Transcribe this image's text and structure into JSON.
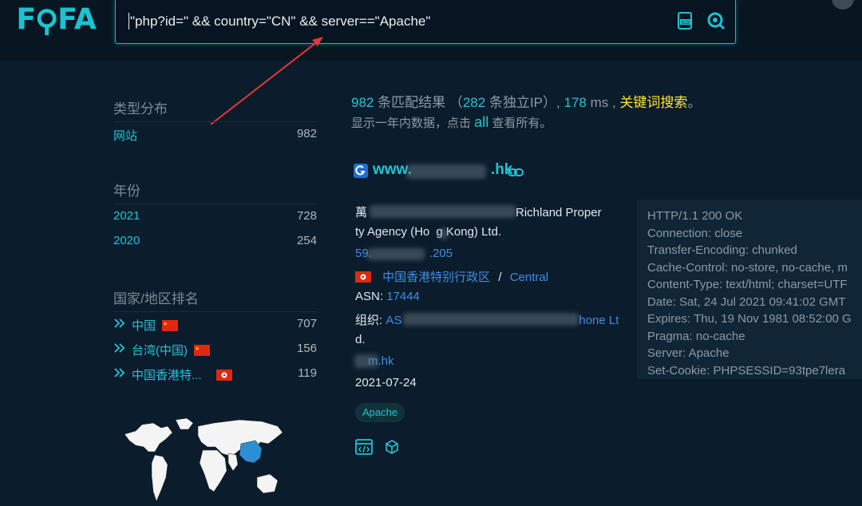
{
  "logo": {
    "text": "FOFA"
  },
  "search": {
    "query": "\"php?id=\" && country=\"CN\" && server==\"Apache\""
  },
  "sidebar": {
    "type_title": "类型分布",
    "type_items": [
      {
        "label": "网站",
        "count": "982"
      }
    ],
    "year_title": "年份",
    "year_items": [
      {
        "label": "2021",
        "count": "728"
      },
      {
        "label": "2020",
        "count": "254"
      }
    ],
    "country_title": "国家/地区排名",
    "country_items": [
      {
        "label": "中国",
        "count": "707",
        "flag": "china"
      },
      {
        "label": "台湾(中国)",
        "count": "156",
        "flag": "china"
      },
      {
        "label": "中国香港特...",
        "count": "119",
        "flag": "hongkong"
      }
    ]
  },
  "summary": {
    "results": "982",
    "results_label": "条匹配结果",
    "ip_open": "（",
    "ips": "282",
    "ips_label": "条独立IP）,",
    "ms": "178",
    "ms_label": "ms ,",
    "keyword_search": "关键词搜索",
    "period": "。",
    "line2_prefix": "显示一年内数据，点击",
    "all": "all",
    "line2_suffix": "查看所有。"
  },
  "result": {
    "host_start": "www.",
    "host_end": ".hk",
    "title_prefix": "萬",
    "title_line1_suffix": "Richland Proper",
    "title_line2_a": "ty Agency (Ho",
    "title_line2_b": "g Kong) Ltd.",
    "ip_start": "59.",
    "ip_end": ".205",
    "region": "中国香港特别行政区",
    "separator": "/",
    "city": "Central",
    "asn_label": "ASN:",
    "asn": "17444",
    "org_label": "组织:",
    "org_start": "AS",
    "org_end": "hone Lt",
    "org_line2": "d.",
    "domain_end": "m.hk",
    "date": "2021-07-24",
    "tag": "Apache"
  },
  "header": {
    "lines": [
      "HTTP/1.1 200 OK",
      "Connection: close",
      "Transfer-Encoding: chunked",
      "Cache-Control: no-store, no-cache, m",
      "Content-Type: text/html; charset=UTF",
      "Date: Sat, 24 Jul 2021 09:41:02 GMT",
      "Expires: Thu, 19 Nov 1981 08:52:00 G",
      "Pragma: no-cache",
      "Server: Apache",
      "Set-Cookie: PHPSESSID=93tpe7lera"
    ]
  },
  "colors": {
    "accent": "#21c5d3",
    "link": "#3e8ee6",
    "keyword": "#ffe233",
    "background": "#0b1c2c"
  }
}
